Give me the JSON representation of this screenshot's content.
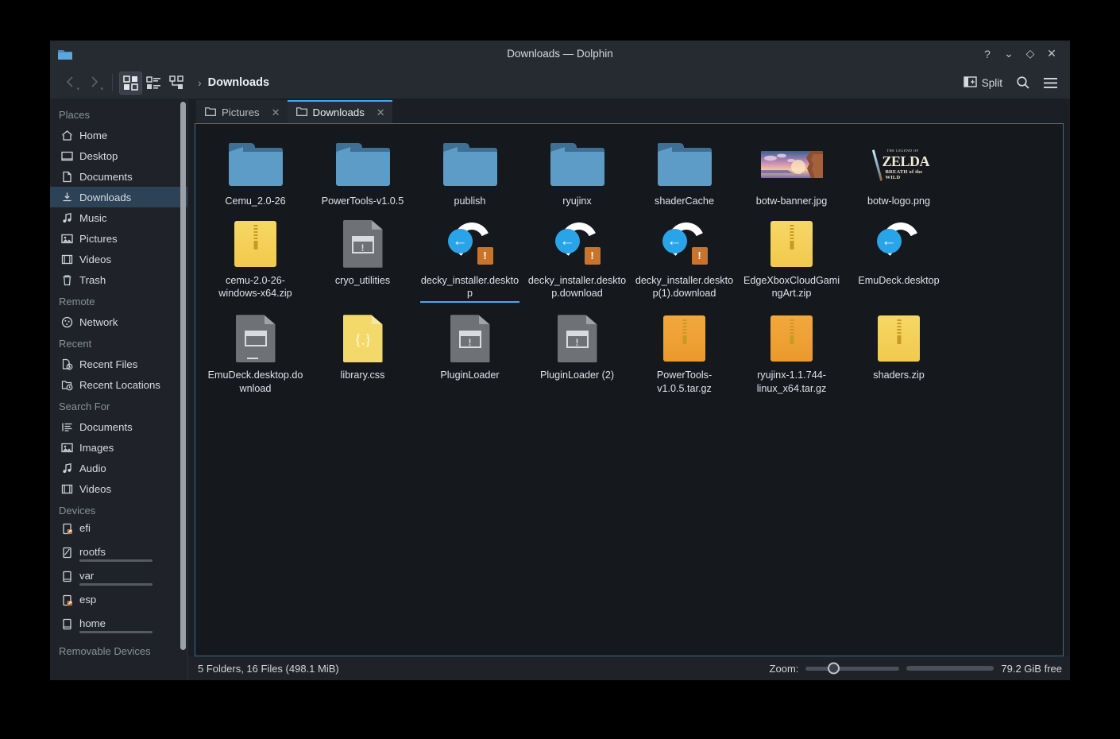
{
  "window": {
    "title": "Downloads — Dolphin",
    "app_icon": "folder-icon",
    "controls": [
      {
        "name": "help-button",
        "glyph": "?"
      },
      {
        "name": "minimize-button",
        "glyph": "⌄"
      },
      {
        "name": "maximize-button",
        "glyph": "◇"
      },
      {
        "name": "close-button",
        "glyph": "✕"
      }
    ]
  },
  "toolbar": {
    "back_label": "‹",
    "forward_label": "›",
    "view_modes": [
      {
        "name": "icons-view-button",
        "active": true
      },
      {
        "name": "compact-view-button",
        "active": false
      },
      {
        "name": "details-view-button",
        "active": false
      }
    ],
    "breadcrumb_separator": "›",
    "breadcrumb_current": "Downloads",
    "split_label": "Split",
    "search_label": "search-icon",
    "menu_label": "hamburger-menu-icon"
  },
  "tabs": [
    {
      "label": "Pictures",
      "active": false,
      "close": "✕"
    },
    {
      "label": "Downloads",
      "active": true,
      "close": "✕"
    }
  ],
  "sidebar": {
    "sections": [
      {
        "title": "Places",
        "items": [
          {
            "label": "Home",
            "icon": "home-icon",
            "selected": false
          },
          {
            "label": "Desktop",
            "icon": "desktop-icon",
            "selected": false
          },
          {
            "label": "Documents",
            "icon": "document-icon",
            "selected": false
          },
          {
            "label": "Downloads",
            "icon": "download-icon",
            "selected": true
          },
          {
            "label": "Music",
            "icon": "music-note-icon",
            "selected": false
          },
          {
            "label": "Pictures",
            "icon": "image-icon",
            "selected": false
          },
          {
            "label": "Videos",
            "icon": "film-icon",
            "selected": false
          },
          {
            "label": "Trash",
            "icon": "trash-icon",
            "selected": false
          }
        ]
      },
      {
        "title": "Remote",
        "items": [
          {
            "label": "Network",
            "icon": "network-icon",
            "selected": false
          }
        ]
      },
      {
        "title": "Recent",
        "items": [
          {
            "label": "Recent Files",
            "icon": "recent-file-icon",
            "selected": false
          },
          {
            "label": "Recent Locations",
            "icon": "recent-folder-icon",
            "selected": false
          }
        ]
      },
      {
        "title": "Search For",
        "items": [
          {
            "label": "Documents",
            "icon": "text-lines-icon",
            "selected": false
          },
          {
            "label": "Images",
            "icon": "image-icon",
            "selected": false
          },
          {
            "label": "Audio",
            "icon": "music-note-icon",
            "selected": false
          },
          {
            "label": "Videos",
            "icon": "film-icon",
            "selected": false
          }
        ]
      }
    ],
    "devices_title": "Devices",
    "devices": [
      {
        "label": "efi",
        "icon": "drive-removable-icon",
        "capacity_percent": null
      },
      {
        "label": "rootfs",
        "icon": "drive-harddisk-root-icon",
        "capacity_percent": 70
      },
      {
        "label": "var",
        "icon": "drive-harddisk-icon",
        "capacity_percent": 24
      },
      {
        "label": "esp",
        "icon": "drive-removable-icon",
        "capacity_percent": null
      },
      {
        "label": "home",
        "icon": "drive-harddisk-icon",
        "capacity_percent": 82
      }
    ],
    "removable_title": "Removable Devices"
  },
  "files": [
    {
      "name": "Cemu_2.0-26",
      "kind": "folder"
    },
    {
      "name": "PowerTools-v1.0.5",
      "kind": "folder"
    },
    {
      "name": "publish",
      "kind": "folder"
    },
    {
      "name": "ryujinx",
      "kind": "folder"
    },
    {
      "name": "shaderCache",
      "kind": "folder"
    },
    {
      "name": "botw-banner.jpg",
      "kind": "image-banner"
    },
    {
      "name": "botw-logo.png",
      "kind": "image-zelda"
    },
    {
      "name": "cemu-2.0-26-windows-x64.zip",
      "kind": "zip"
    },
    {
      "name": "cryo_utilities",
      "kind": "script"
    },
    {
      "name": "decky_installer.desktop",
      "kind": "download-warn",
      "hovered": true
    },
    {
      "name": "decky_installer.desktop.download",
      "kind": "download-warn"
    },
    {
      "name": "decky_installer.desktop(1).download",
      "kind": "download-warn"
    },
    {
      "name": "EdgeXboxCloudGamingArt.zip",
      "kind": "zip"
    },
    {
      "name": "EmuDeck.desktop",
      "kind": "download"
    },
    {
      "name": "EmuDeck.desktop.download",
      "kind": "script-plain"
    },
    {
      "name": "library.css",
      "kind": "css"
    },
    {
      "name": "PluginLoader",
      "kind": "script"
    },
    {
      "name": "PluginLoader (2)",
      "kind": "script"
    },
    {
      "name": "PowerTools-v1.0.5.tar.gz",
      "kind": "targz"
    },
    {
      "name": "ryujinx-1.1.744-linux_x64.tar.gz",
      "kind": "targz"
    },
    {
      "name": "shaders.zip",
      "kind": "zip"
    }
  ],
  "statusbar": {
    "summary": "5 Folders, 16 Files (498.1 MiB)",
    "zoom_label": "Zoom:",
    "zoom_percent": 29,
    "free_percent": 80,
    "free_label": "79.2 GiB free"
  },
  "colors": {
    "accent": "#3daee9",
    "window_bg": "#1b1e24",
    "sidebar_bg": "#1f2229",
    "titlebar_bg": "#262a31",
    "selection": "#2b4257",
    "folder": "#5d9cc6",
    "zip": "#f2c94c",
    "targz": "#eb9a2c"
  }
}
